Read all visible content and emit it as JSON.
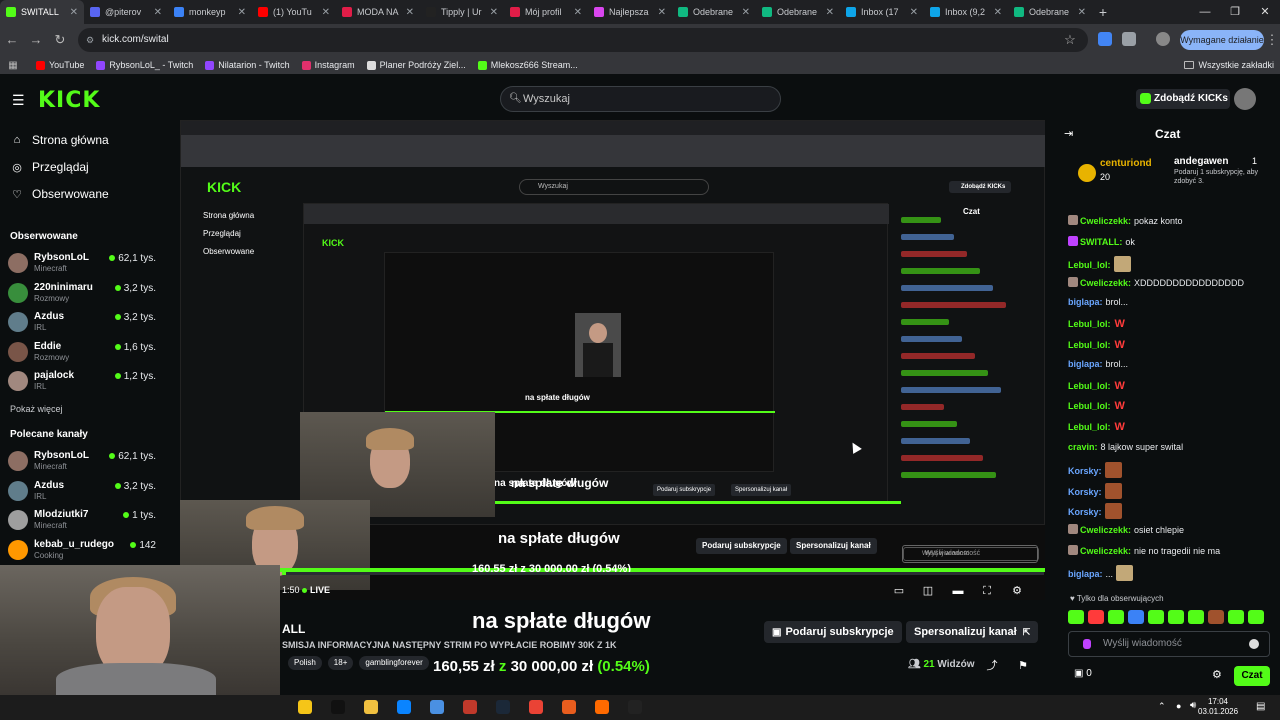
{
  "browser": {
    "tabs": [
      {
        "label": "SWITALL",
        "color": "#53fc18",
        "active": true
      },
      {
        "label": "@piterov",
        "color": "#5865f2"
      },
      {
        "label": "monkeyp",
        "color": "#3b82f6"
      },
      {
        "label": "(1) YouTu",
        "color": "#ff0000"
      },
      {
        "label": "MODA NA",
        "color": "#e11d48"
      },
      {
        "label": "Tipply | Ur",
        "color": "#222222"
      },
      {
        "label": "Mój profil",
        "color": "#e11d48"
      },
      {
        "label": "Najlepsza",
        "color": "#d946ef"
      },
      {
        "label": "Odebrane",
        "color": "#10b981"
      },
      {
        "label": "Odebrane",
        "color": "#10b981"
      },
      {
        "label": "Inbox (17",
        "color": "#0ea5e9"
      },
      {
        "label": "Inbox (9,2",
        "color": "#0ea5e9"
      },
      {
        "label": "Odebrane",
        "color": "#10b981"
      }
    ],
    "url": "kick.com/swital",
    "required_action": "Wymagane działanie",
    "bookmarks": [
      {
        "label": "YouTube",
        "color": "#ff0000"
      },
      {
        "label": "RybsonLoL_ - Twitch",
        "color": "#9146ff"
      },
      {
        "label": "Nilatarion - Twitch",
        "color": "#9146ff"
      },
      {
        "label": "Instagram",
        "color": "#e1306c"
      },
      {
        "label": "Planer Podróży Ziel...",
        "color": "#dddddd"
      },
      {
        "label": "Mlekosz666 Stream...",
        "color": "#53fc18"
      }
    ],
    "all_bookmarks": "Wszystkie zakładki"
  },
  "header": {
    "logo": "KICK",
    "search_placeholder": "Wyszukaj",
    "get_kicks": "Zdobądź KICKs"
  },
  "sidebar": {
    "nav": [
      {
        "label": "Strona główna",
        "icon": "home-icon"
      },
      {
        "label": "Przeglądaj",
        "icon": "compass-icon"
      },
      {
        "label": "Obserwowane",
        "icon": "heart-icon"
      }
    ],
    "followed_title": "Obserwowane",
    "followed": [
      {
        "name": "RybsonLoL",
        "category": "Minecraft",
        "viewers": "62,1 tys.",
        "color": "#8d6e63"
      },
      {
        "name": "220ninimaru",
        "category": "Rozmowy",
        "viewers": "3,2 tys.",
        "color": "#388e3c"
      },
      {
        "name": "Azdus",
        "category": "IRL",
        "viewers": "3,2 tys.",
        "color": "#607d8b"
      },
      {
        "name": "Eddie",
        "category": "Rozmowy",
        "viewers": "1,6 tys.",
        "color": "#795548"
      },
      {
        "name": "pajalock",
        "category": "IRL",
        "viewers": "1,2 tys.",
        "color": "#a1887f"
      }
    ],
    "show_more": "Pokaż więcej",
    "recommended_title": "Polecane kanały",
    "recommended": [
      {
        "name": "RybsonLoL",
        "category": "Minecraft",
        "viewers": "62,1 tys.",
        "color": "#8d6e63"
      },
      {
        "name": "Azdus",
        "category": "IRL",
        "viewers": "3,2 tys.",
        "color": "#607d8b"
      },
      {
        "name": "Mlodziutki7",
        "category": "Minecraft",
        "viewers": "1 tys.",
        "color": "#9e9e9e"
      },
      {
        "name": "kebab_u_rudego",
        "category": "Cooking",
        "viewers": "142",
        "color": "#ff9800"
      }
    ]
  },
  "stream": {
    "live_time": "1:50",
    "live_label": "LIVE",
    "channel_short": "ALL",
    "title": "na spłate długów",
    "subtitle": "SMISJA INFORMACYJNA NASTĘPNY STRIM PO WYPŁACIE ROBIMY 30K Z 1K",
    "tags": [
      "Polish",
      "18+",
      "gamblingforever"
    ],
    "goal_current": "160,55 zł",
    "goal_sep": "z",
    "goal_target": "30 000,00 zł",
    "goal_percent": "(0.54%)",
    "goal_fraction": 0.0054,
    "gift_sub": "Podaruj subskrypcje",
    "customize": "Spersonalizuj kanał",
    "viewers_count": "21",
    "viewers_label": "Widzów"
  },
  "nested": {
    "title_1": "na spłate długów",
    "title_2": "na spłate długów",
    "title_3": "na spłate długów",
    "goal_1": "160,55 zł z 30 000,00 zł (0.54%)",
    "gift_sub": "Podaruj subskrypcje",
    "customize": "Spersonalizuj kanał",
    "chat_title": "Czat",
    "input_placeholder": "Wyślij wiadomość",
    "search": "Wyszukaj",
    "get_kicks": "Zdobądź KICKs",
    "nav_home": "Strona główna",
    "nav_browse": "Przeglądaj",
    "nav_follow": "Obserwowane"
  },
  "chat": {
    "title": "Czat",
    "pinned": {
      "user1": "centuriond",
      "count1": "20",
      "user2": "andegawen",
      "count2": "1",
      "note": "Podaruj 1 subskrypcję, aby zdobyć 3."
    },
    "messages": [
      {
        "user": "Cweliczekk",
        "color": "#53fc18",
        "text": "pokaz konto",
        "badge": "#a1887f"
      },
      {
        "user": "SWITALL",
        "color": "#53fc18",
        "text": "ok",
        "badge": "#c042ff"
      },
      {
        "user": "Lebul_lol",
        "color": "#53fc18",
        "text": "",
        "emote": "#c2a878"
      },
      {
        "user": "Cweliczekk",
        "color": "#53fc18",
        "text": "XDDDDDDDDDDDDDDDD",
        "badge": "#a1887f"
      },
      {
        "user": "biglapa",
        "color": "#6aa6ff",
        "text": "brol..."
      },
      {
        "user": "Lebul_lol",
        "color": "#53fc18",
        "w": "W"
      },
      {
        "user": "Lebul_lol",
        "color": "#53fc18",
        "w": "W"
      },
      {
        "user": "biglapa",
        "color": "#6aa6ff",
        "text": "brol..."
      },
      {
        "user": "Lebul_lol",
        "color": "#53fc18",
        "w": "W"
      },
      {
        "user": "Lebul_lol",
        "color": "#53fc18",
        "w": "W"
      },
      {
        "user": "Lebul_lol",
        "color": "#53fc18",
        "w": "W"
      },
      {
        "user": "cravin",
        "color": "#53fc18",
        "text": "8 lajkow super swital"
      },
      {
        "user": "Korsky",
        "color": "#6aa6ff",
        "emote": "#a0522d"
      },
      {
        "user": "Korsky",
        "color": "#6aa6ff",
        "emote": "#a0522d"
      },
      {
        "user": "Korsky",
        "color": "#6aa6ff",
        "emote": "#a0522d"
      },
      {
        "user": "Cweliczekk",
        "color": "#53fc18",
        "text": "osiet chlepie",
        "badge": "#a1887f"
      },
      {
        "user": "Cweliczekk",
        "color": "#53fc18",
        "text": "nie no tragedii nie ma",
        "badge": "#a1887f"
      },
      {
        "user": "biglapa",
        "color": "#6aa6ff",
        "text": "...",
        "emote": "#c2a878"
      }
    ],
    "subs_only": "Tylko dla obserwujących",
    "input_placeholder": "Wyślij wiadomość",
    "count": "0",
    "send": "Czat"
  },
  "taskbar": {
    "time": "17:04",
    "date": "03.01.2026"
  },
  "colors": {
    "kick_green": "#53fc18",
    "bg": "#0b0e0f",
    "panel": "#24272c"
  }
}
